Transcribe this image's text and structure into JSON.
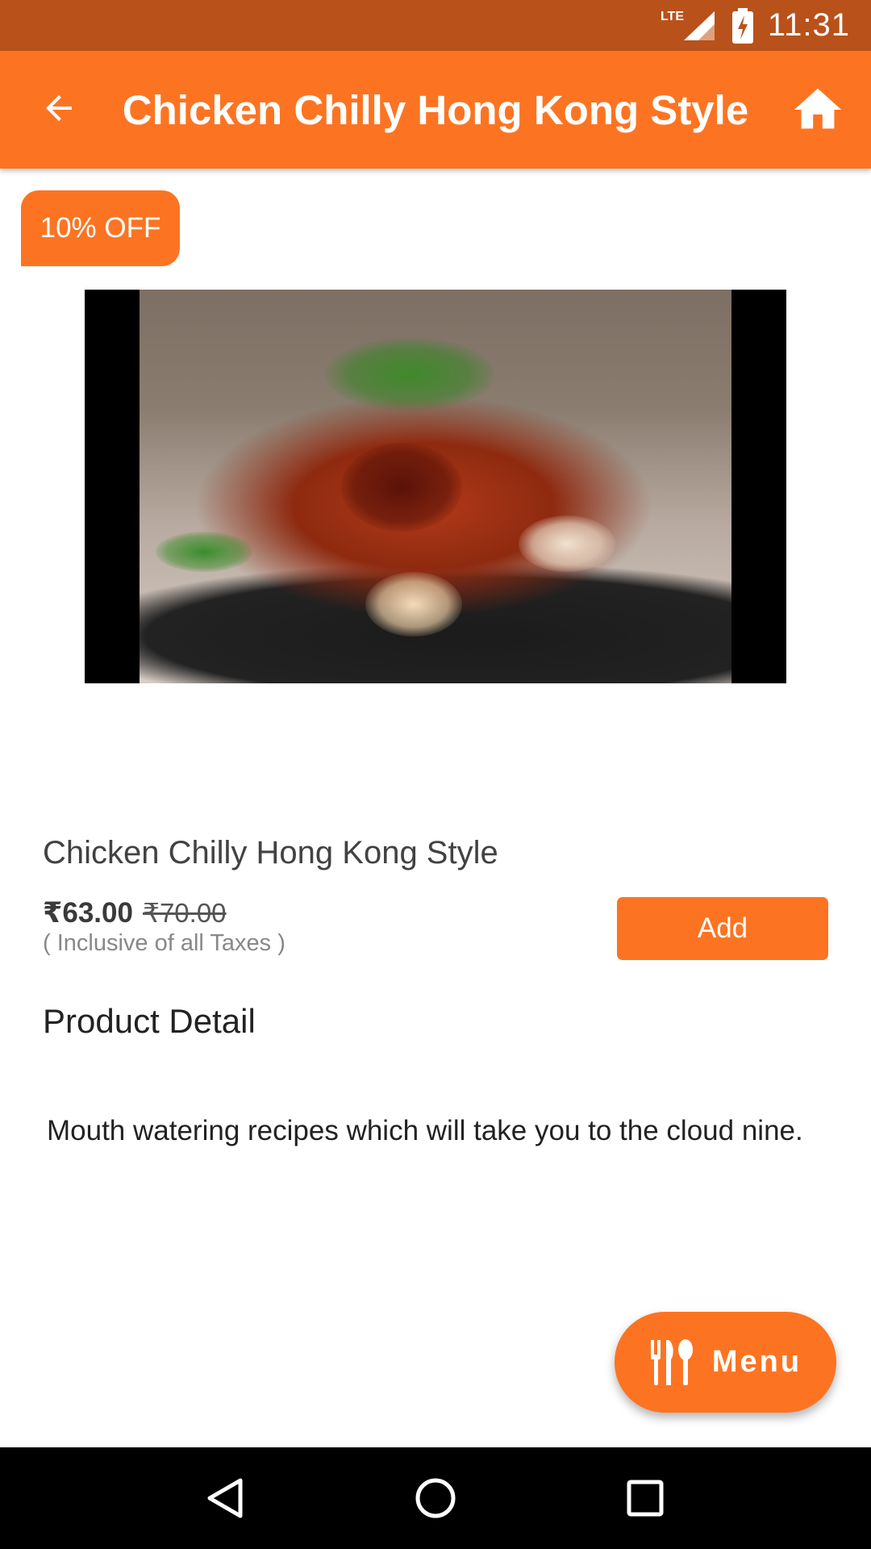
{
  "status_bar": {
    "network_label": "LTE",
    "time": "11:31",
    "icons": [
      "lte-signal-icon",
      "battery-charging-icon"
    ]
  },
  "app_bar": {
    "title": "Chicken Chilly Hong Kong Style",
    "back_icon": "arrow-back-icon",
    "home_icon": "home-icon"
  },
  "badge": {
    "label": "10% OFF"
  },
  "product": {
    "name": "Chicken Chilly Hong Kong Style",
    "price_current": "₹63.00",
    "price_original": "₹70.00",
    "tax_note": "( Inclusive of all Taxes )",
    "add_label": "Add",
    "image_icon": "dish-photo"
  },
  "detail": {
    "section_title": "Product Detail",
    "description": "Mouth watering recipes which will take you to the cloud nine."
  },
  "fab": {
    "label": "Menu",
    "icon": "cutlery-icon"
  },
  "nav": {
    "back_icon": "nav-back-icon",
    "home_icon": "nav-home-icon",
    "recents_icon": "nav-recents-icon"
  },
  "colors": {
    "status_bar": "#b9511b",
    "accent": "#fc7422",
    "nav_bar": "#000000"
  }
}
